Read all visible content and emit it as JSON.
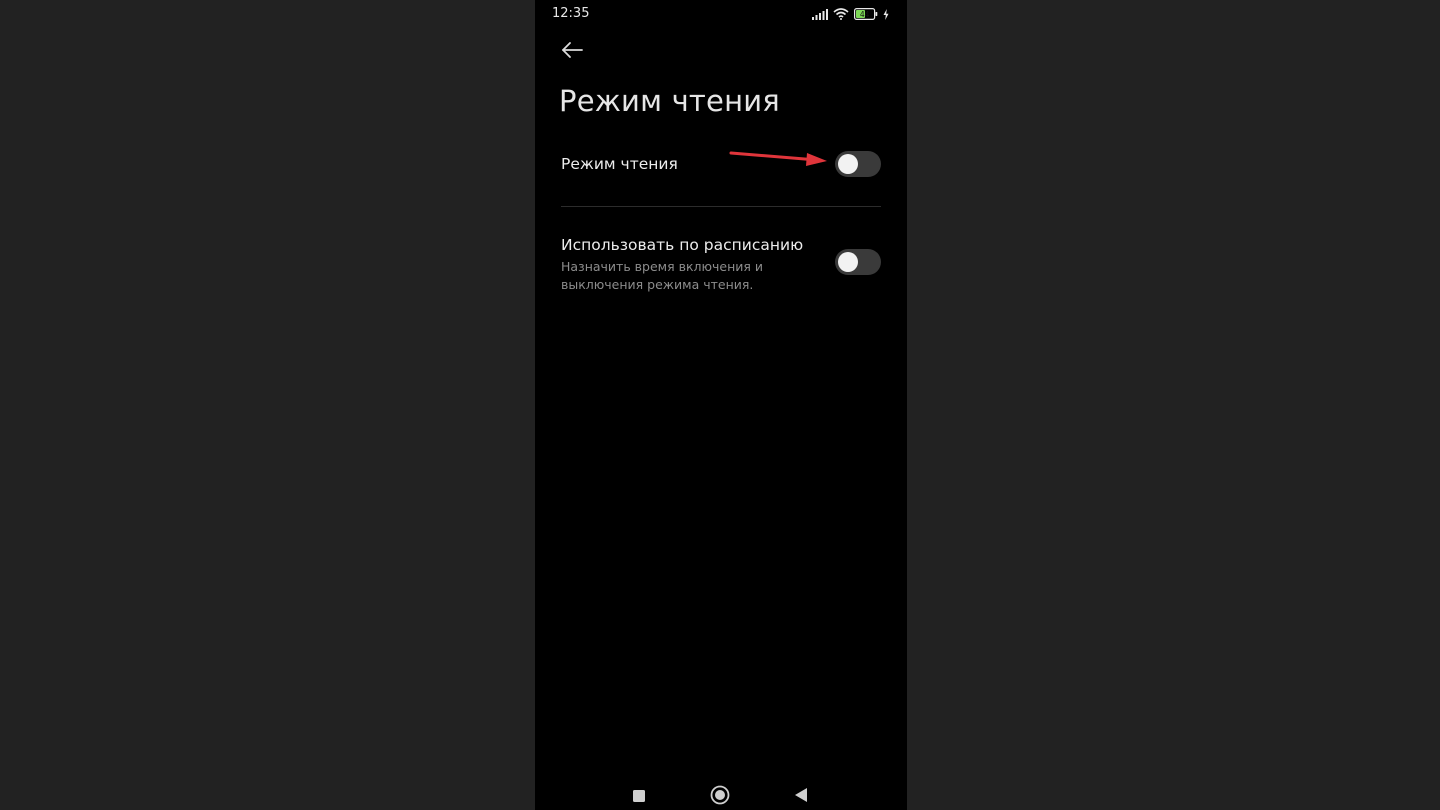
{
  "status_bar": {
    "time": "12:35",
    "battery_level": "44",
    "icons": [
      "signal-icon",
      "wifi-icon",
      "battery-icon",
      "charging-icon"
    ]
  },
  "header": {
    "back_icon": "arrow-left-icon",
    "title": "Режим чтения"
  },
  "settings": {
    "reading_mode": {
      "label": "Режим чтения",
      "enabled": false
    },
    "schedule": {
      "label": "Использовать по расписанию",
      "description": "Назначить время включения и выключения режима чтения.",
      "enabled": false
    }
  },
  "annotation": {
    "color": "#e0353b"
  },
  "nav_bar": {
    "icons": [
      "recents-square-icon",
      "home-circle-icon",
      "back-triangle-icon"
    ]
  },
  "colors": {
    "page_background": "#222222",
    "screen_background": "#000000",
    "toggle_off": "#3a3a3a",
    "battery_green": "#7ed957"
  }
}
